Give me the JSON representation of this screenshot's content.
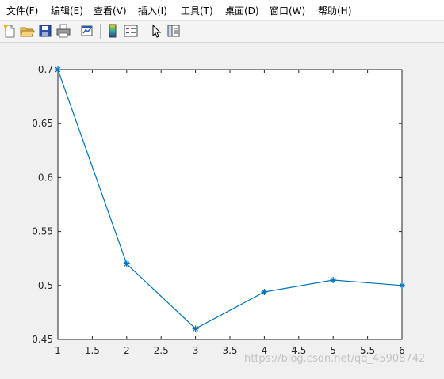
{
  "menubar": {
    "items": [
      {
        "label": "文件(F)",
        "accel": "F"
      },
      {
        "label": "编辑(E)",
        "accel": "E"
      },
      {
        "label": "查看(V)",
        "accel": "V"
      },
      {
        "label": "插入(I)",
        "accel": "I"
      },
      {
        "label": "工具(T)",
        "accel": "T"
      },
      {
        "label": "桌面(D)",
        "accel": "D"
      },
      {
        "label": "窗口(W)",
        "accel": "W"
      },
      {
        "label": "帮助(H)",
        "accel": "H"
      }
    ]
  },
  "toolbar": {
    "icons": [
      "new-figure-icon",
      "open-file-icon",
      "save-icon",
      "print-icon",
      "link-plot-icon",
      "insert-colorbar-icon",
      "insert-legend-icon",
      "edit-plot-cursor-icon",
      "property-inspector-icon"
    ]
  },
  "chart_data": {
    "type": "line",
    "x": [
      1,
      2,
      3,
      4,
      5,
      6
    ],
    "series": [
      {
        "values": [
          0.7,
          0.52,
          0.46,
          0.494,
          0.505,
          0.5
        ],
        "marker": "*",
        "color": "#0072bd"
      }
    ],
    "xlim": [
      1,
      6
    ],
    "ylim": [
      0.45,
      0.7
    ],
    "xticks": [
      "1",
      "1.5",
      "2",
      "2.5",
      "3",
      "3.5",
      "4",
      "4.5",
      "5",
      "5.5",
      "6"
    ],
    "yticks": [
      "0.45",
      "0.5",
      "0.55",
      "0.6",
      "0.65",
      "0.7"
    ],
    "title": "",
    "xlabel": "",
    "ylabel": "",
    "grid": false
  },
  "watermark": "https://blog.csdn.net/qq_45908742"
}
